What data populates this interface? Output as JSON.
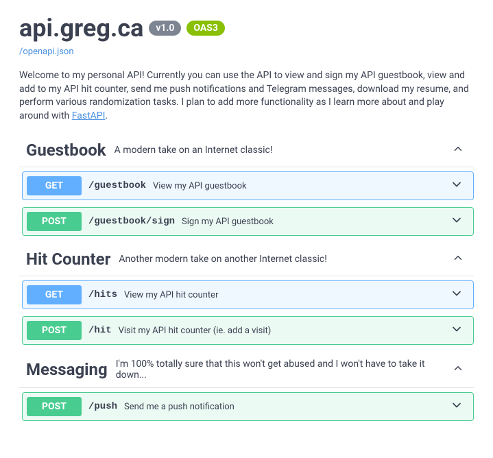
{
  "header": {
    "title": "api.greg.ca",
    "version": "v1.0",
    "oas": "OAS3",
    "spec_link": "/openapi.json"
  },
  "description": {
    "pre": "Welcome to my personal API! Currently you can use the API to view and sign my API guestbook, view and add to my API hit counter, send me push notifications and Telegram messages, download my resume, and perform various randomization tasks. I plan to add more functionality as I learn more about and play around with ",
    "link_text": "FastAPI",
    "post": "."
  },
  "tags": [
    {
      "name": "Guestbook",
      "desc": "A modern take on an Internet classic!",
      "ops": [
        {
          "method": "GET",
          "path": "/guestbook",
          "summary": "View my API guestbook"
        },
        {
          "method": "POST",
          "path": "/guestbook/sign",
          "summary": "Sign my API guestbook"
        }
      ]
    },
    {
      "name": "Hit Counter",
      "desc": "Another modern take on another Internet classic!",
      "ops": [
        {
          "method": "GET",
          "path": "/hits",
          "summary": "View my API hit counter"
        },
        {
          "method": "POST",
          "path": "/hit",
          "summary": "Visit my API hit counter (ie. add a visit)"
        }
      ]
    },
    {
      "name": "Messaging",
      "desc": "I'm 100% totally sure that this won't get abused and I won't have to take it down...",
      "ops": [
        {
          "method": "POST",
          "path": "/push",
          "summary": "Send me a push notification"
        }
      ]
    }
  ]
}
